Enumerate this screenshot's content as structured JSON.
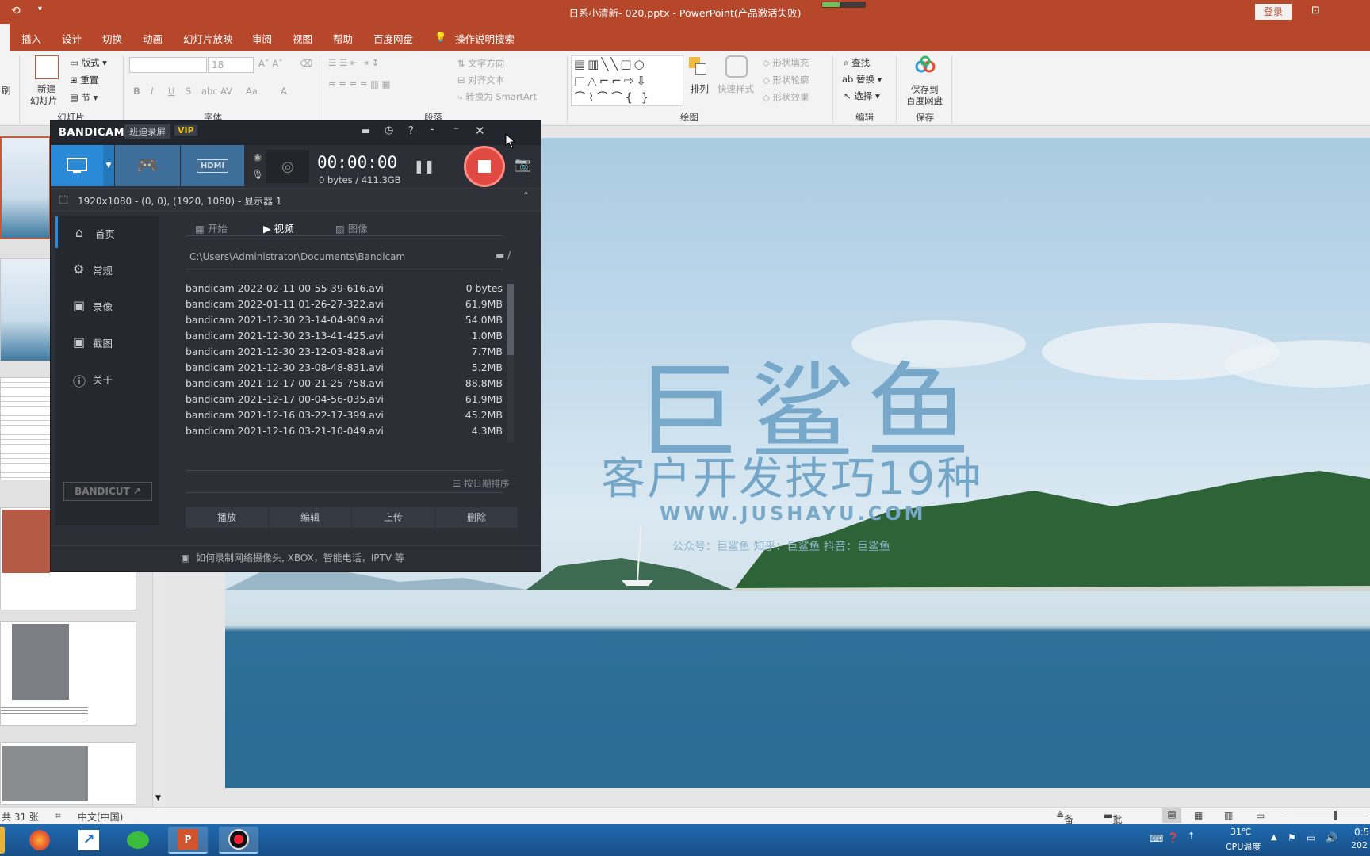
{
  "titlebar": {
    "title": "日系小清新- 020.pptx  -  PowerPoint(产品激活失败)",
    "login": "登录",
    "recording_progress": 0.4
  },
  "tabs": [
    "插入",
    "设计",
    "切换",
    "动画",
    "幻灯片放映",
    "审阅",
    "视图",
    "帮助",
    "百度网盘"
  ],
  "tell_me": "操作说明搜索",
  "ribbon": {
    "slides": {
      "new_slide": "新建",
      "new_slide2": "幻灯片",
      "layout": "版式",
      "reset": "重置",
      "section": "节",
      "group": "幻灯片"
    },
    "font": {
      "size": "18",
      "group": "字体"
    },
    "paragraph": {
      "text_dir": "文字方向",
      "align_text": "对齐文本",
      "smartart": "转换为 SmartArt",
      "group": "段落"
    },
    "drawing": {
      "arrange": "排列",
      "quick_styles": "快速样式",
      "fill": "形状填充",
      "outline": "形状轮廓",
      "effects": "形状效果",
      "group": "绘图"
    },
    "editing": {
      "find": "查找",
      "replace": "替换",
      "select": "选择",
      "group": "编辑"
    },
    "save": {
      "save_to": "保存到",
      "baidu": "百度网盘",
      "group": "保存"
    }
  },
  "bandicam": {
    "brand": "BANDICAM",
    "brand_cn": "班迪录屏",
    "vip": "VIP",
    "timer": "00:00:00",
    "size": "0 bytes / 411.3GB",
    "area": "1920x1080 - (0, 0), (1920, 1080) - 显示器 1",
    "sidebar": [
      "首页",
      "常规",
      "录像",
      "截图",
      "关于"
    ],
    "subtabs": [
      "开始",
      "视频",
      "图像"
    ],
    "path": "C:\\Users\\Administrator\\Documents\\Bandicam",
    "files": [
      {
        "name": "bandicam 2022-02-11 00-55-39-616.avi",
        "size": "0 bytes"
      },
      {
        "name": "bandicam 2022-01-11 01-26-27-322.avi",
        "size": "61.9MB"
      },
      {
        "name": "bandicam 2021-12-30 23-14-04-909.avi",
        "size": "54.0MB"
      },
      {
        "name": "bandicam 2021-12-30 23-13-41-425.avi",
        "size": "1.0MB"
      },
      {
        "name": "bandicam 2021-12-30 23-12-03-828.avi",
        "size": "7.7MB"
      },
      {
        "name": "bandicam 2021-12-30 23-08-48-831.avi",
        "size": "5.2MB"
      },
      {
        "name": "bandicam 2021-12-17 00-21-25-758.avi",
        "size": "88.8MB"
      },
      {
        "name": "bandicam 2021-12-17 00-04-56-035.avi",
        "size": "61.9MB"
      },
      {
        "name": "bandicam 2021-12-16 03-22-17-399.avi",
        "size": "45.2MB"
      },
      {
        "name": "bandicam 2021-12-16 03-21-10-049.avi",
        "size": "4.3MB"
      }
    ],
    "sort": "按日期排序",
    "actions": [
      "播放",
      "编辑",
      "上传",
      "删除"
    ],
    "bandicut": "BANDICUT",
    "tip": "如何录制网络摄像头, XBOX，智能电话，IPTV 等"
  },
  "slide": {
    "title": "巨鲨鱼",
    "subtitle": "客户开发技巧19种",
    "url": "WWW.JUSHAYU.COM",
    "social": "公众号：巨鲨鱼   知乎：巨鲨鱼   抖音：巨鲨鱼"
  },
  "statusbar": {
    "slides": "共 31 张",
    "lang": "中文(中国)",
    "notes": "备注",
    "comments": "批注"
  },
  "taskbar": {
    "temp": "31℃",
    "cpu": "CPU温度",
    "time": "0:5",
    "year": "202"
  }
}
